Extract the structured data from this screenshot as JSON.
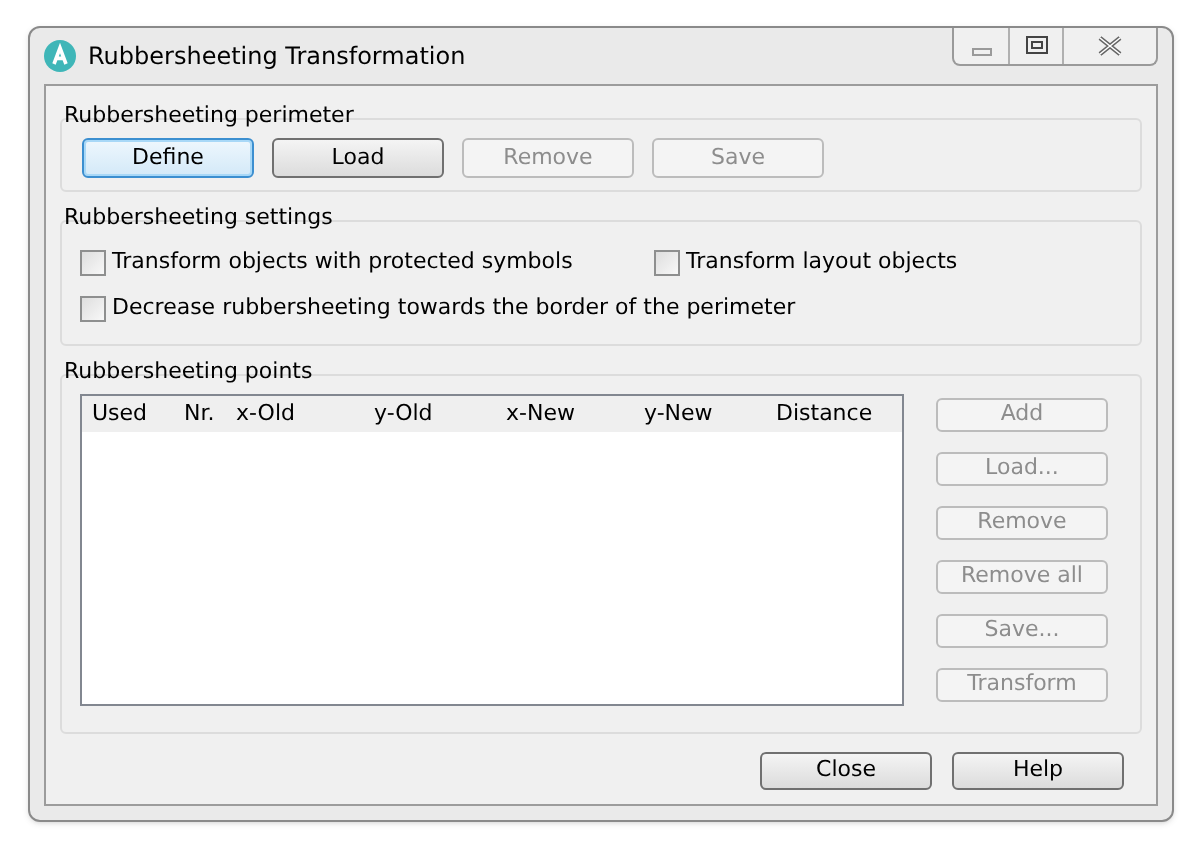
{
  "window": {
    "title": "Rubbersheeting Transformation"
  },
  "perimeter": {
    "title": "Rubbersheeting perimeter",
    "buttons": [
      {
        "label": "Define",
        "disabled": false,
        "focused": true
      },
      {
        "label": "Load",
        "disabled": false,
        "focused": false
      },
      {
        "label": "Remove",
        "disabled": true,
        "focused": false
      },
      {
        "label": "Save",
        "disabled": true,
        "focused": false
      }
    ]
  },
  "settings": {
    "title": "Rubbersheeting settings",
    "rows": [
      [
        {
          "label": "Transform objects with protected symbols",
          "checked": false
        },
        {
          "label": "Transform layout objects",
          "checked": false
        }
      ],
      [
        {
          "label": "Decrease rubbersheeting towards the border of the perimeter",
          "checked": false
        }
      ]
    ]
  },
  "points": {
    "title": "Rubbersheeting points",
    "columns": [
      "Used",
      "Nr.",
      "x-Old",
      "y-Old",
      "x-New",
      "y-New",
      "Distance"
    ],
    "buttons": [
      {
        "label": "Add",
        "disabled": true
      },
      {
        "label": "Load...",
        "disabled": true
      },
      {
        "label": "Remove",
        "disabled": true
      },
      {
        "label": "Remove all",
        "disabled": true
      },
      {
        "label": "Save...",
        "disabled": true
      },
      {
        "label": "Transform",
        "disabled": true
      }
    ]
  },
  "footer": {
    "buttons": [
      {
        "label": "Close",
        "disabled": false
      },
      {
        "label": "Help",
        "disabled": false
      }
    ]
  }
}
